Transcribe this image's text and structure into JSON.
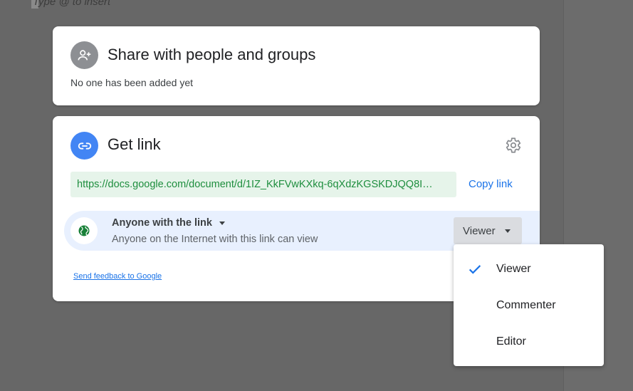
{
  "document": {
    "hint_text": "Type @ to insert"
  },
  "share_section": {
    "title": "Share with people and groups",
    "subtitle": "No one has been added yet",
    "icon": "add-person-icon"
  },
  "link_section": {
    "title": "Get link",
    "icon": "link-icon",
    "settings_icon": "gear-icon",
    "url": "https://docs.google.com/document/d/1IZ_KkFVwKXkq-6qXdzKGSKDJQQ8I…",
    "copy_label": "Copy link",
    "access": {
      "title": "Anyone with the link",
      "description": "Anyone on the Internet with this link can view",
      "icon": "globe-icon",
      "role": "Viewer"
    },
    "feedback_label": "Send feedback to Google"
  },
  "role_menu": {
    "items": [
      {
        "label": "Viewer",
        "selected": true
      },
      {
        "label": "Commenter",
        "selected": false
      },
      {
        "label": "Editor",
        "selected": false
      }
    ]
  },
  "colors": {
    "accent_blue": "#1a73e8",
    "link_green": "#1e8e3e",
    "link_bg": "#e6f4ea",
    "access_bg": "#e8f0fe"
  }
}
